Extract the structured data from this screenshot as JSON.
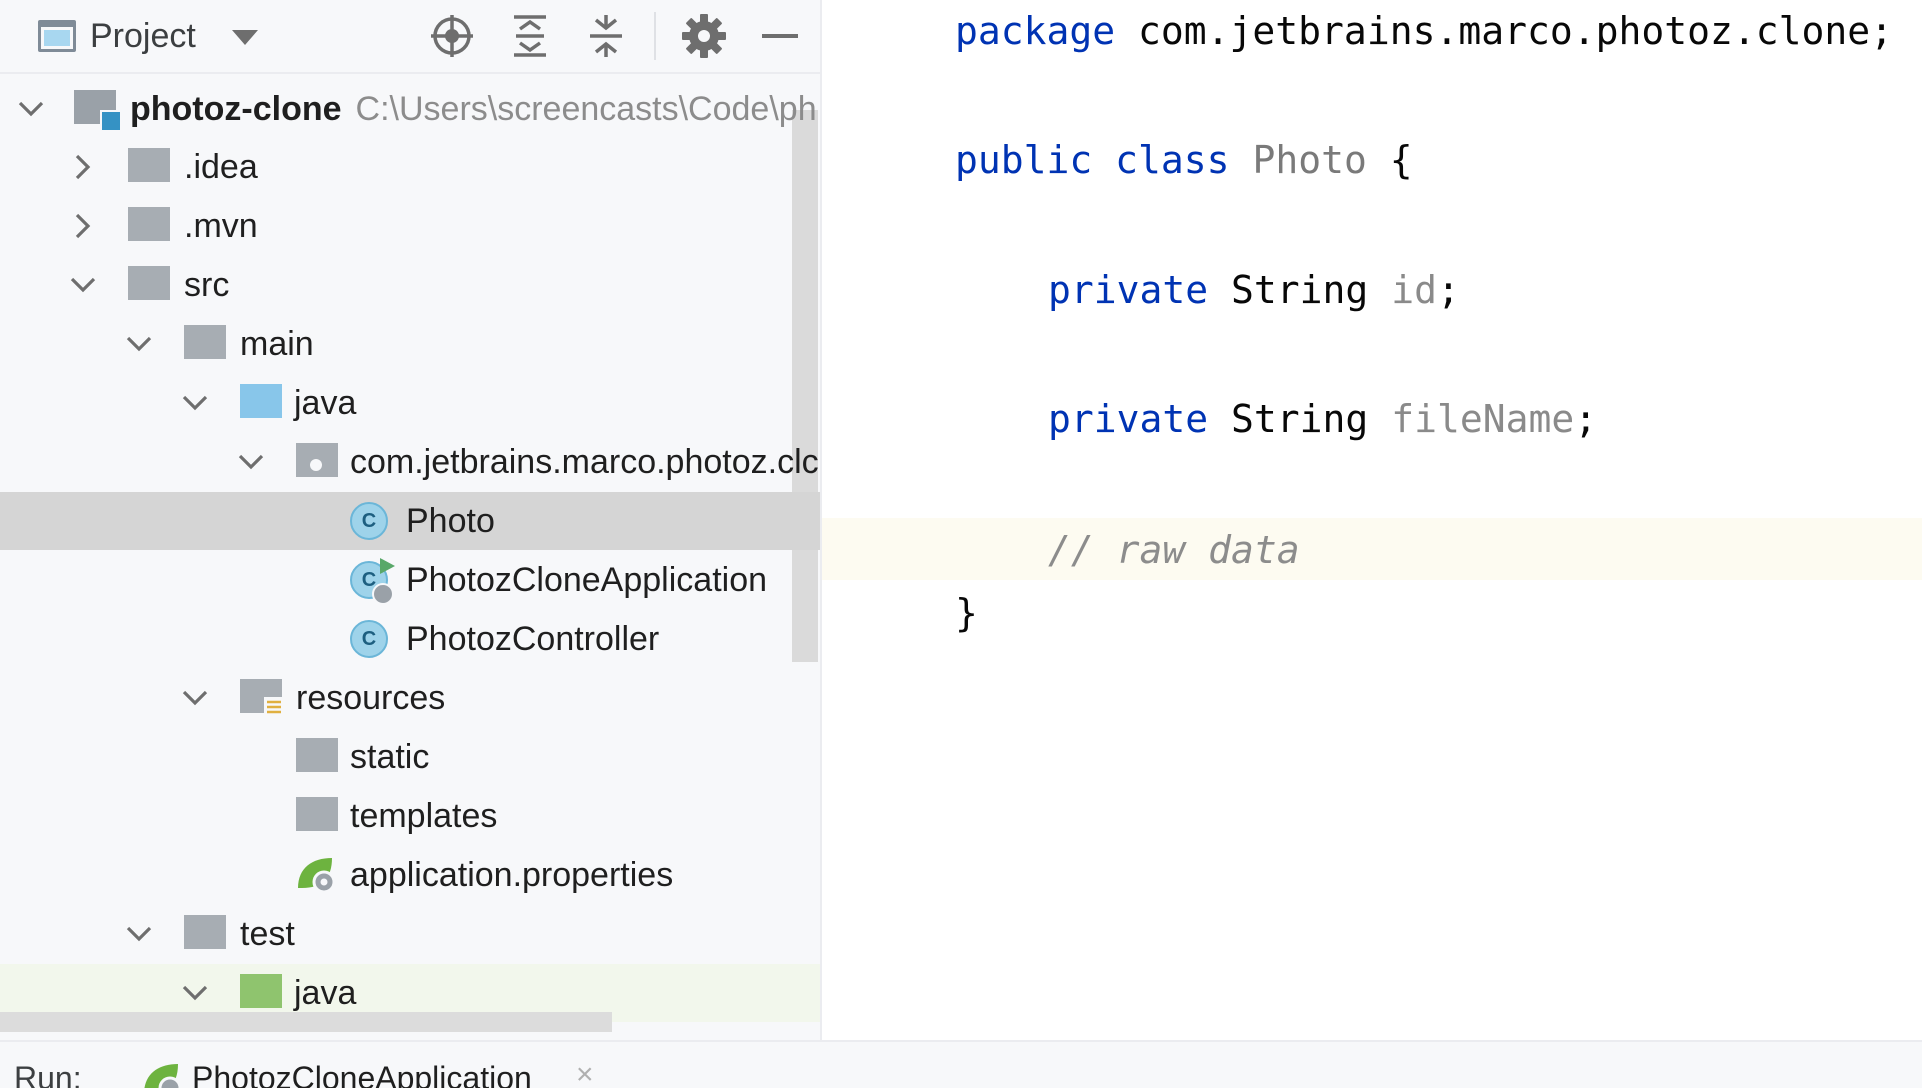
{
  "project_panel": {
    "title": "Project",
    "toolbar_icons": [
      "select-opened-file-icon",
      "expand-all-icon",
      "collapse-all-icon",
      "gear-icon",
      "minimize-icon"
    ]
  },
  "tree": {
    "root": {
      "label": "photoz-clone",
      "path": "C:\\Users\\screencasts\\Code\\ph"
    },
    "idea": ".idea",
    "mvn": ".mvn",
    "src": "src",
    "main": "main",
    "java": "java",
    "package": "com.jetbrains.marco.photoz.clc",
    "photo": "Photo",
    "app": "PhotozCloneApplication",
    "controller": "PhotozController",
    "resources": "resources",
    "static": "static",
    "templates": "templates",
    "properties": "application.properties",
    "test": "test",
    "test_java": "java"
  },
  "editor": {
    "line1_kw": "package",
    "line1_rest": " com.jetbrains.marco.photoz.clone;",
    "line2_kw1": "public",
    "line2_kw2": "class",
    "line2_name": "Photo",
    "line2_brace": " {",
    "line3_kw": "private",
    "line3_type": " String ",
    "line3_field": "id",
    "line3_semi": ";",
    "line4_kw": "private",
    "line4_type": " String ",
    "line4_field": "fileName",
    "line4_semi": ";",
    "line5_comment": "// raw data",
    "line6_brace": "}"
  },
  "bottom": {
    "run_label": "Run:",
    "run_tab": "PhotozCloneApplication",
    "close_glyph": "×"
  }
}
